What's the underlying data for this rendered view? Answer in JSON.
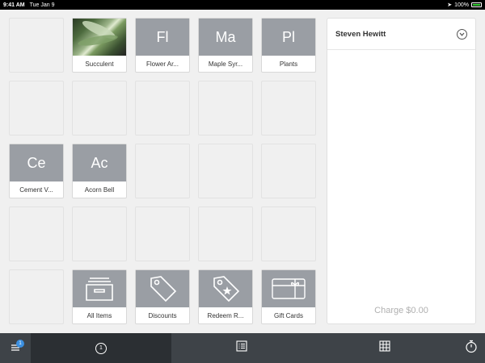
{
  "status_bar": {
    "time": "9:41 AM",
    "date": "Tue Jan 9",
    "battery_text": "100%"
  },
  "items": [
    {
      "label": "Succulent",
      "abbr": "",
      "has_image": true
    },
    {
      "label": "Flower Ar...",
      "abbr": "Fl"
    },
    {
      "label": "Maple Syr...",
      "abbr": "Ma"
    },
    {
      "label": "Plants",
      "abbr": "Pl"
    },
    {
      "label": "Cement V...",
      "abbr": "Ce"
    },
    {
      "label": "Acorn Bell",
      "abbr": "Ac"
    }
  ],
  "actions": [
    {
      "label": "All Items",
      "icon": "archive-box-icon"
    },
    {
      "label": "Discounts",
      "icon": "tag-icon"
    },
    {
      "label": "Redeem R...",
      "icon": "star-tag-icon"
    },
    {
      "label": "Gift Cards",
      "icon": "gift-card-icon"
    }
  ],
  "cart": {
    "customer_name": "Steven Hewitt",
    "charge_label": "Charge $0.00"
  },
  "nav": {
    "menu_badge": "1",
    "cart_count": "1",
    "icons": [
      "menu-icon",
      "cart-count-icon",
      "list-icon",
      "grid-icon",
      "timer-icon"
    ]
  },
  "colors": {
    "tile_placeholder": "#9a9ea4",
    "nav_bg": "#3e4348",
    "nav_active": "#2b2f33",
    "badge": "#3b8fe0"
  }
}
